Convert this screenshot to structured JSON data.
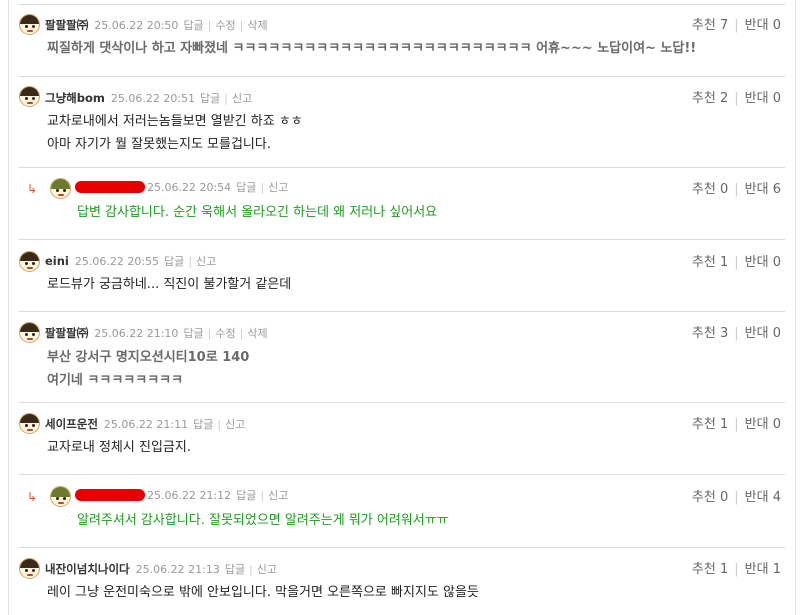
{
  "actions": {
    "reply": "답글",
    "edit": "수정",
    "delete": "삭제",
    "report": "신고"
  },
  "vote_labels": {
    "up": "추천",
    "down": "반대"
  },
  "reply_arrow": "↳",
  "comments": [
    {
      "nick": "팔팔팔㈜",
      "date": "25.06.22 20:50",
      "up": "7",
      "down": "0",
      "lines": [
        "찌질하게 댓삭이나 하고 자빠졌네 ㅋㅋㅋㅋㅋㅋㅋㅋㅋㅋㅋㅋㅋㅋㅋㅋㅋㅋㅋㅋㅋㅋㅋㅋㅋ 어휴~~~ 노답이여~ 노답!!"
      ]
    },
    {
      "nick": "그냥해bom",
      "date": "25.06.22 20:51",
      "up": "2",
      "down": "0",
      "lines": [
        "교차로내에서 저러는놈들보면 열받긴 하죠 ㅎㅎ",
        "아마 자기가 뭘 잘못했는지도 모를겁니다."
      ]
    },
    {
      "nick": "",
      "date": "25.06.22 20:54",
      "up": "0",
      "down": "6",
      "lines": [
        "답변 감사합니다. 순간 욱해서 올라오긴 하는데 왜 저러나 싶어서요"
      ]
    },
    {
      "nick": "eini",
      "date": "25.06.22 20:55",
      "up": "1",
      "down": "0",
      "lines": [
        "로드뷰가 궁금하네... 직진이 불가할거 같은데"
      ]
    },
    {
      "nick": "팔팔팔㈜",
      "date": "25.06.22 21:10",
      "up": "3",
      "down": "0",
      "lines": [
        "부산 강서구 명지오션시티10로 140",
        "여기네 ㅋㅋㅋㅋㅋㅋㅋㅋ"
      ]
    },
    {
      "nick": "세이프운전",
      "date": "25.06.22 21:11",
      "up": "1",
      "down": "0",
      "lines": [
        "교자로내 정체시 진입금지."
      ]
    },
    {
      "nick": "",
      "date": "25.06.22 21:12",
      "up": "0",
      "down": "4",
      "lines": [
        "알려주셔서 감사합니다. 잘못되었으면 알려주는게 뭐가 어려워서ㅠㅠ"
      ]
    },
    {
      "nick": "내잔이넘치나이다",
      "date": "25.06.22 21:13",
      "up": "1",
      "down": "1",
      "lines": [
        "레이 그냥 운전미숙으로 밖에 안보입니다. 막을거면 오른쪽으로 빠지지도 않을듯"
      ]
    }
  ]
}
